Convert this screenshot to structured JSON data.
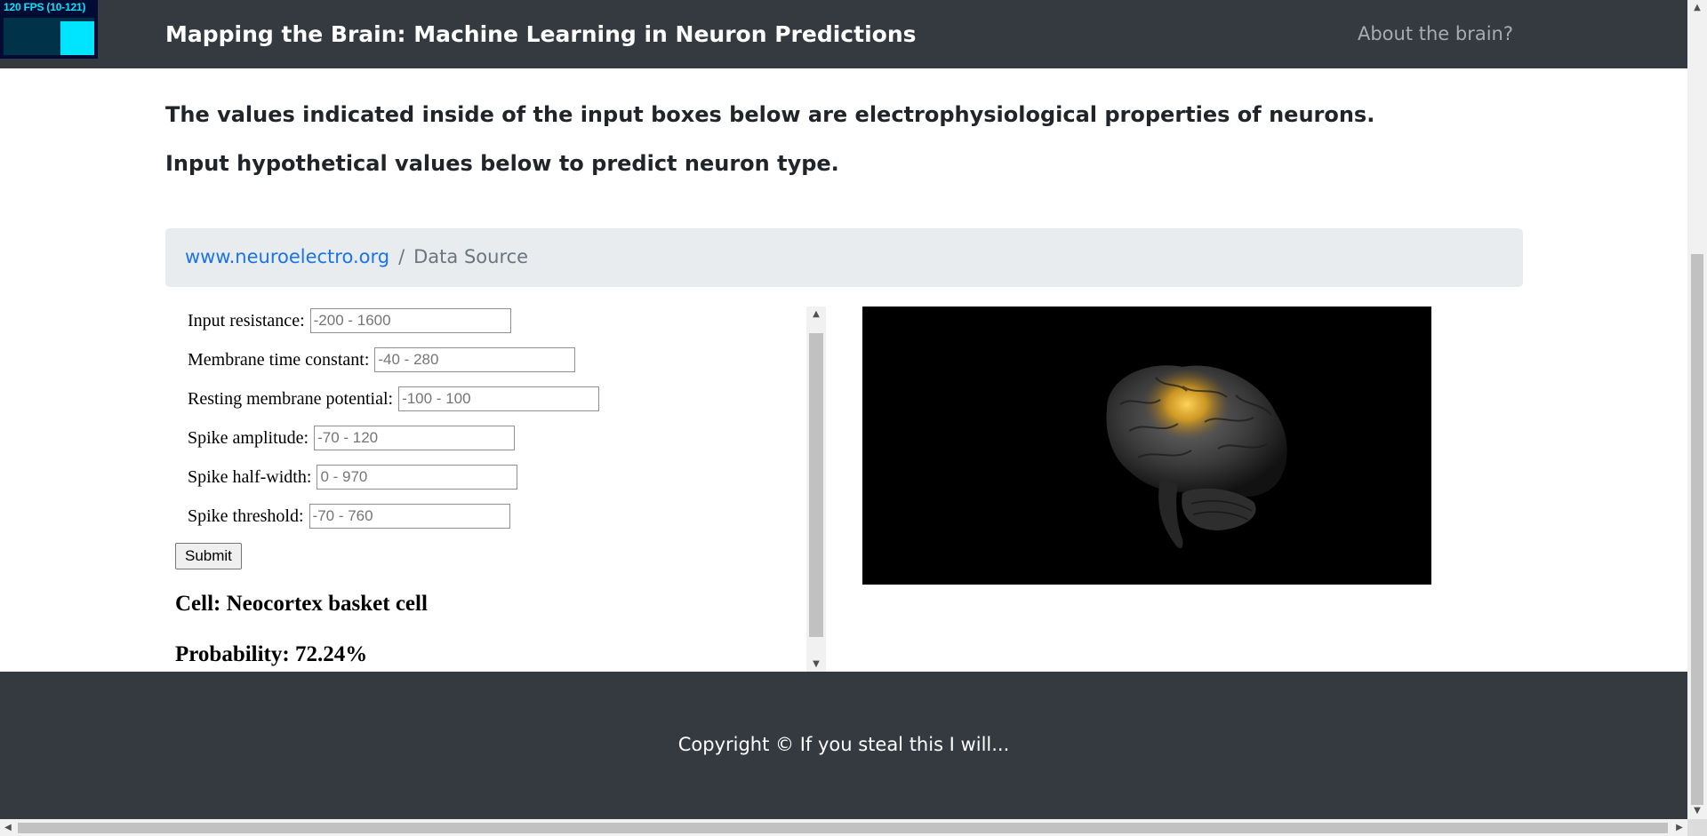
{
  "fps_meter": {
    "label": "120 FPS (10-121)",
    "level": 0.9
  },
  "navbar": {
    "brand": "Mapping the Brain: Machine Learning in Neuron Predictions",
    "link": "About the brain?"
  },
  "intro": {
    "line1": "The values indicated inside of the input boxes below are electrophysiological properties of neurons.",
    "line2": "Input hypothetical values below to predict neuron type."
  },
  "breadcrumb": {
    "link": "www.neuroelectro.org",
    "separator": "/",
    "active": "Data Source"
  },
  "form": {
    "fields": [
      {
        "label": "Input resistance:",
        "placeholder": "-200 - 1600"
      },
      {
        "label": "Membrane time constant:",
        "placeholder": "-40 - 280"
      },
      {
        "label": "Resting membrane potential:",
        "placeholder": "-100 - 100"
      },
      {
        "label": "Spike amplitude:",
        "placeholder": "-70 - 120"
      },
      {
        "label": "Spike half-width:",
        "placeholder": "0 - 970"
      },
      {
        "label": "Spike threshold:",
        "placeholder": "-70 - 760"
      }
    ],
    "submit_label": "Submit"
  },
  "result": {
    "cell": "Cell: Neocortex basket cell",
    "probability": "Probability: 72.24%"
  },
  "footer": {
    "copyright": "Copyright © If you steal this I will..."
  },
  "colors": {
    "navbar_bg": "#343a40",
    "breadcrumb_bg": "#e9ecef",
    "link": "#1a73e8",
    "brain_glow": "#f2b81f"
  },
  "icons": {
    "scroll_up": "▲",
    "scroll_down": "▼",
    "scroll_left": "◀",
    "scroll_right": "▶"
  }
}
